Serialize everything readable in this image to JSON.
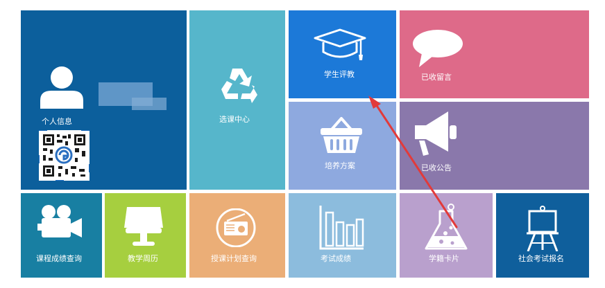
{
  "colors": {
    "personal": "#0c5f9c",
    "course": "#56b6cb",
    "evaluation": "#1c79d8",
    "messages": "#de6a89",
    "plan": "#8ea9df",
    "announcements": "#8a78ab",
    "grades_query": "#187fa2",
    "calendar": "#a6cf3f",
    "schedule": "#ebae77",
    "exam_results": "#8cbcdd",
    "student_card": "#b9a0cd",
    "social_exam": "#0f5f9c",
    "arrow": "#e23a3a"
  },
  "tiles": {
    "personal": {
      "label": "个人信息",
      "icon": "user-icon"
    },
    "course": {
      "label": "选课中心",
      "icon": "recycle-icon"
    },
    "evaluation": {
      "label": "学生评教",
      "icon": "graduation-cap-icon"
    },
    "messages": {
      "label": "已收留言",
      "icon": "speech-bubble-icon"
    },
    "plan": {
      "label": "培养方案",
      "icon": "basket-icon"
    },
    "announcements": {
      "label": "已收公告",
      "icon": "megaphone-icon"
    },
    "grades_query": {
      "label": "课程成绩查询",
      "icon": "video-camera-icon"
    },
    "calendar": {
      "label": "教学周历",
      "icon": "lamp-icon"
    },
    "schedule": {
      "label": "授课计划查询",
      "icon": "radio-icon"
    },
    "exam_results": {
      "label": "考试成绩",
      "icon": "bar-chart-icon"
    },
    "student_card": {
      "label": "学籍卡片",
      "icon": "flask-icon"
    },
    "social_exam": {
      "label": "社会考试报名",
      "icon": "easel-icon"
    }
  }
}
